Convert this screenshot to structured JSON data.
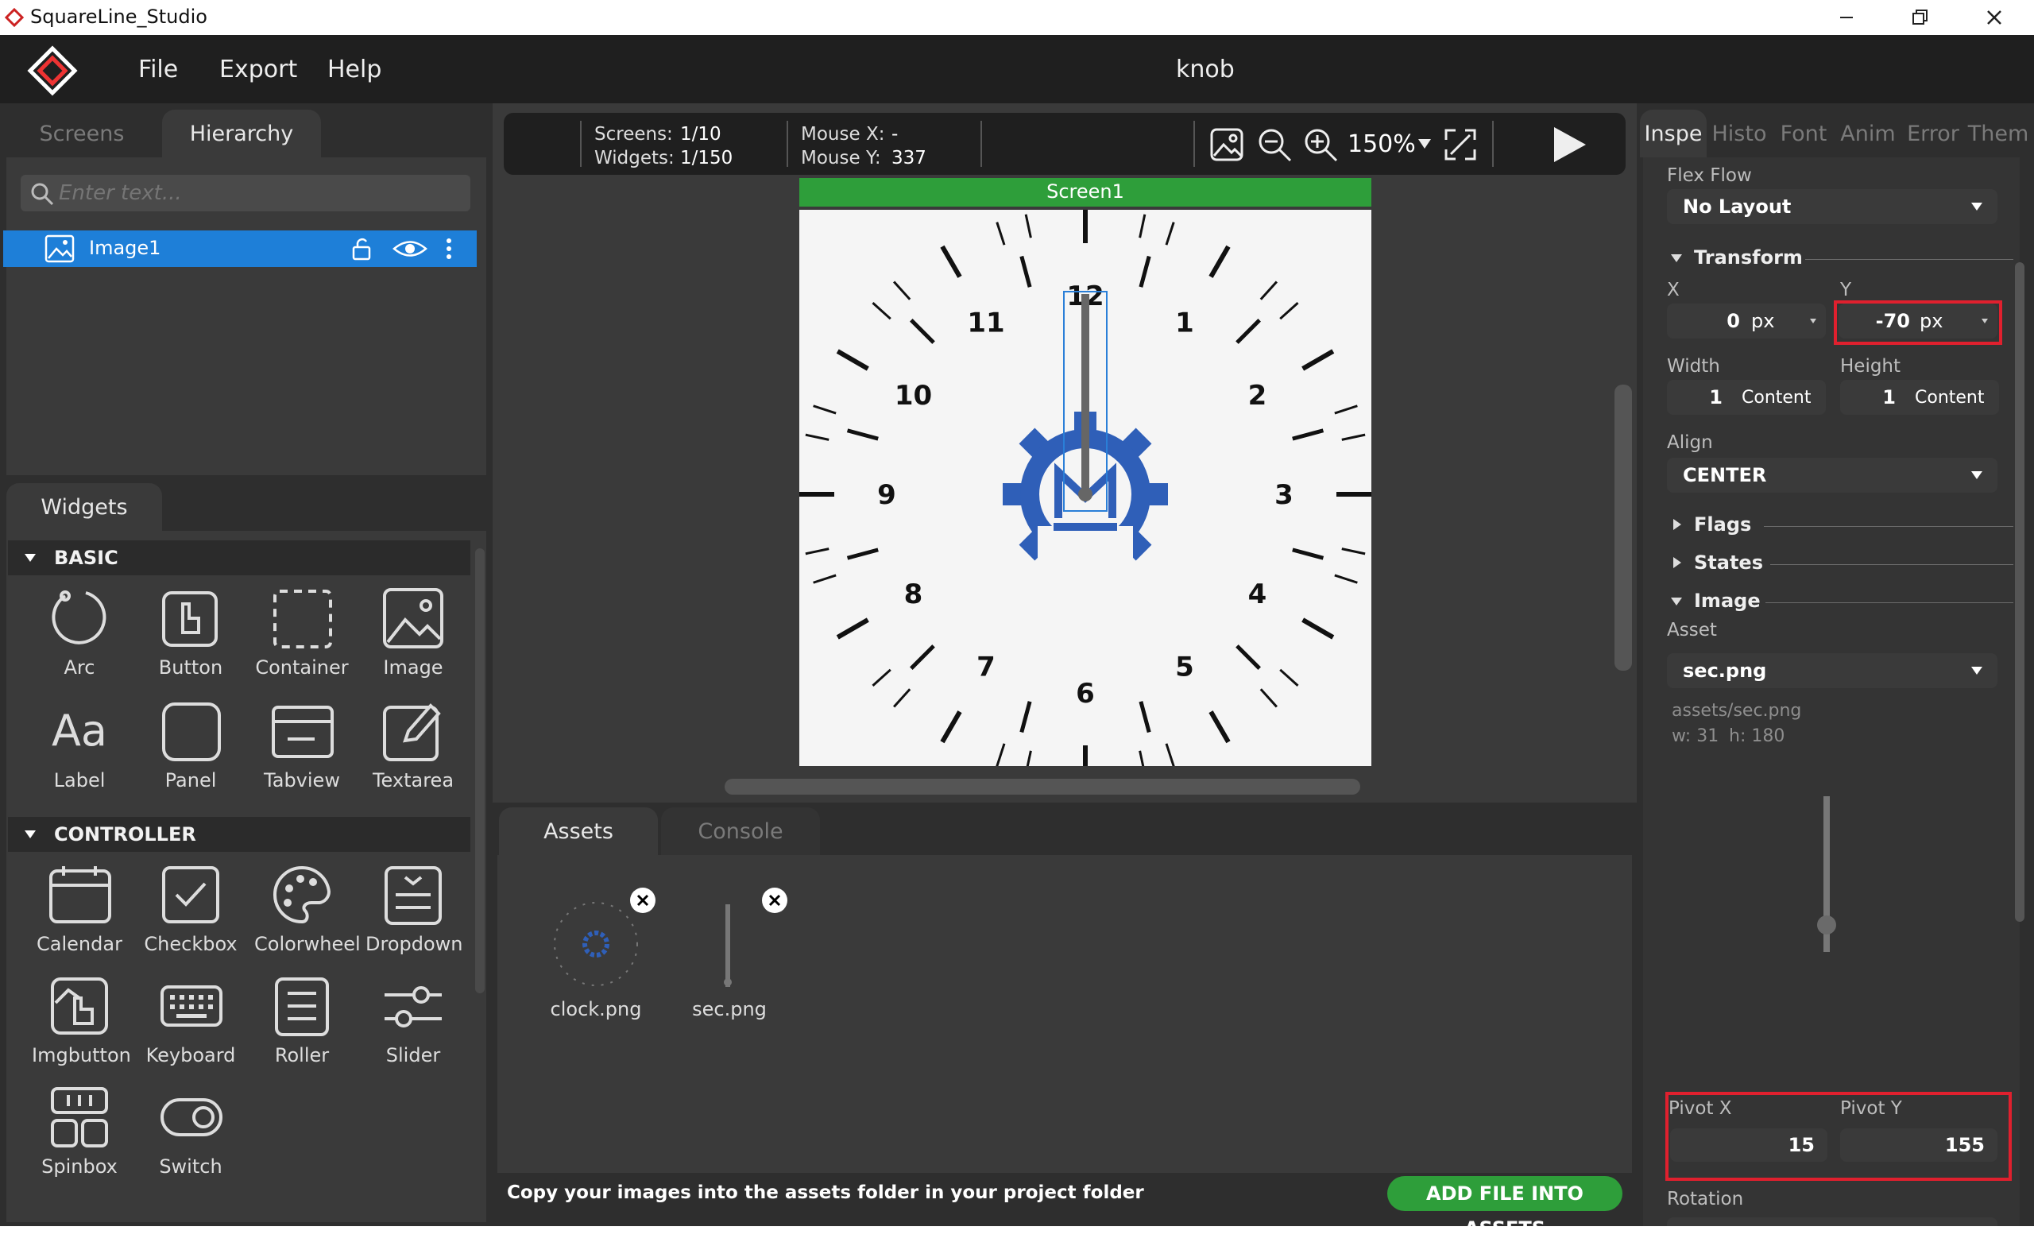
{
  "window": {
    "title": "SquareLine_Studio",
    "project": "knob"
  },
  "menu": [
    "File",
    "Export",
    "Help"
  ],
  "left_tabs": {
    "screens": "Screens",
    "hierarchy": "Hierarchy"
  },
  "search": {
    "placeholder": "Enter text..."
  },
  "hierarchy": {
    "item": "Image1"
  },
  "widgets": {
    "tab": "Widgets",
    "basic_title": "BASIC",
    "basic": [
      "Arc",
      "Button",
      "Container",
      "Image",
      "Label",
      "Panel",
      "Tabview",
      "Textarea"
    ],
    "controller_title": "CONTROLLER",
    "controller": [
      "Calendar",
      "Checkbox",
      "Colorwheel",
      "Dropdown",
      "Imgbutton",
      "Keyboard",
      "Roller",
      "Slider",
      "Spinbox",
      "Switch"
    ]
  },
  "toolbar": {
    "screens_label": "Screens:",
    "screens_value": "1/10",
    "widgets_label": "Widgets:",
    "widgets_value": "1/150",
    "mousex_label": "Mouse X:",
    "mousex_value": "-",
    "mousey_label": "Mouse Y:",
    "mousey_value": "337",
    "zoom": "150%"
  },
  "canvas": {
    "screen_title": "Screen1",
    "numbers": [
      "12",
      "1",
      "2",
      "3",
      "4",
      "5",
      "6",
      "7",
      "8",
      "9",
      "10",
      "11"
    ]
  },
  "bottom_tabs": {
    "assets": "Assets",
    "console": "Console"
  },
  "assets": [
    {
      "name": "clock.png"
    },
    {
      "name": "sec.png"
    }
  ],
  "assets_hint": "Copy your images into the assets folder in your project folder",
  "add_button": "ADD FILE INTO ASSETS",
  "inspector": {
    "tabs": [
      "Inspe",
      "Histo",
      "Font",
      "Anim",
      "Error",
      "Them"
    ],
    "flex_flow_label": "Flex Flow",
    "flex_flow_value": "No Layout",
    "transform": "Transform",
    "x_label": "X",
    "x_value": "0",
    "x_unit": "px",
    "y_label": "Y",
    "y_value": "-70",
    "y_unit": "px",
    "width_label": "Width",
    "width_value": "1",
    "width_unit": "Content",
    "height_label": "Height",
    "height_value": "1",
    "height_unit": "Content",
    "align_label": "Align",
    "align_value": "CENTER",
    "flags": "Flags",
    "states": "States",
    "image": "Image",
    "asset_label": "Asset",
    "asset_value": "sec.png",
    "asset_path": "assets/sec.png",
    "asset_w": "w: 31",
    "asset_h": "h: 180",
    "pivot_x_label": "Pivot X",
    "pivot_x_value": "15",
    "pivot_y_label": "Pivot Y",
    "pivot_y_value": "155",
    "rotation_label": "Rotation"
  },
  "colors": {
    "accent": "#2e9e3a",
    "selection": "#1e7fd8",
    "highlight": "#e0202e",
    "gear": "#2f5fb8"
  }
}
